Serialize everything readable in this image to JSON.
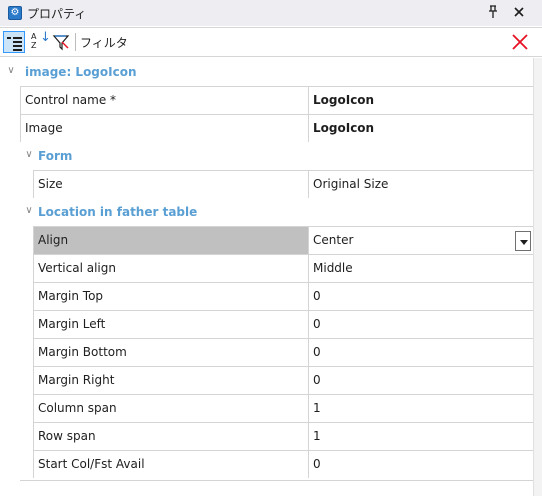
{
  "window": {
    "title": "プロパティ",
    "pin_symbol": "ᵖ",
    "close_symbol": "✕"
  },
  "toolbar": {
    "filter_label": "フィルタ",
    "search_value": "",
    "clear_color": "#e81123"
  },
  "colors": {
    "category_text": "#5a9fd4",
    "selected_row": "#c0c0c0",
    "grid_lines": "#d4d4d4"
  },
  "sections": {
    "root": {
      "label": "image: LogoIcon",
      "properties": [
        {
          "name": "Control name *",
          "value": "LogoIcon",
          "bold": true
        },
        {
          "name": "Image",
          "value": "LogoIcon",
          "bold": true
        }
      ]
    },
    "form": {
      "label": "Form",
      "properties": [
        {
          "name": "Size",
          "value": "Original Size"
        }
      ]
    },
    "location": {
      "label": "Location in father table",
      "properties": [
        {
          "name": "Align",
          "value": "Center",
          "selected": true,
          "has_dropdown": true
        },
        {
          "name": "Vertical align",
          "value": "Middle"
        },
        {
          "name": "Margin Top",
          "value": "0"
        },
        {
          "name": "Margin Left",
          "value": "0"
        },
        {
          "name": "Margin Bottom",
          "value": "0"
        },
        {
          "name": "Margin Right",
          "value": "0"
        },
        {
          "name": "Column span",
          "value": "1"
        },
        {
          "name": "Row span",
          "value": "1"
        },
        {
          "name": "Start Col/Fst Avail",
          "value": "0"
        }
      ]
    }
  }
}
